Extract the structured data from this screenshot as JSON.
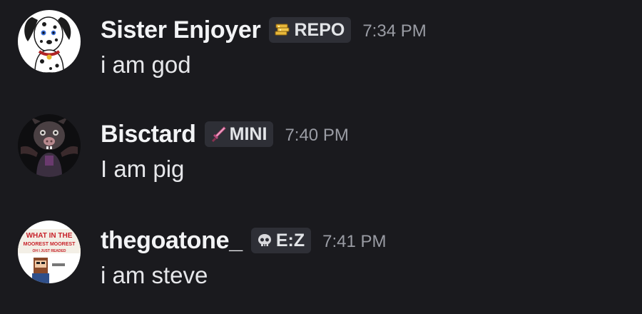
{
  "messages": [
    {
      "username": "Sister Enjoyer",
      "tag_icon": "gold-coins-icon",
      "tag_label": "REPO",
      "timestamp": "7:34 PM",
      "content": "i am god",
      "avatar": "dalmatian-dog-avatar"
    },
    {
      "username": "Bisctard",
      "tag_icon": "pink-sword-icon",
      "tag_label": "MINI",
      "timestamp": "7:40 PM",
      "content": "I am pig",
      "avatar": "pig-character-avatar"
    },
    {
      "username": "thegoatone_",
      "tag_icon": "skull-icon",
      "tag_label": "E:Z",
      "timestamp": "7:41 PM",
      "content": "i am steve",
      "avatar": "meme-text-avatar",
      "avatar_text": [
        "WHAT IN THE",
        "MOOREST MOOREST",
        "OH I JUST READED"
      ]
    }
  ],
  "colors": {
    "background": "#1a1a1e",
    "username": "#f2f3f5",
    "tag_background": "#2e2f36",
    "timestamp": "#9a9ca4",
    "message_text": "#e6e7ea"
  }
}
